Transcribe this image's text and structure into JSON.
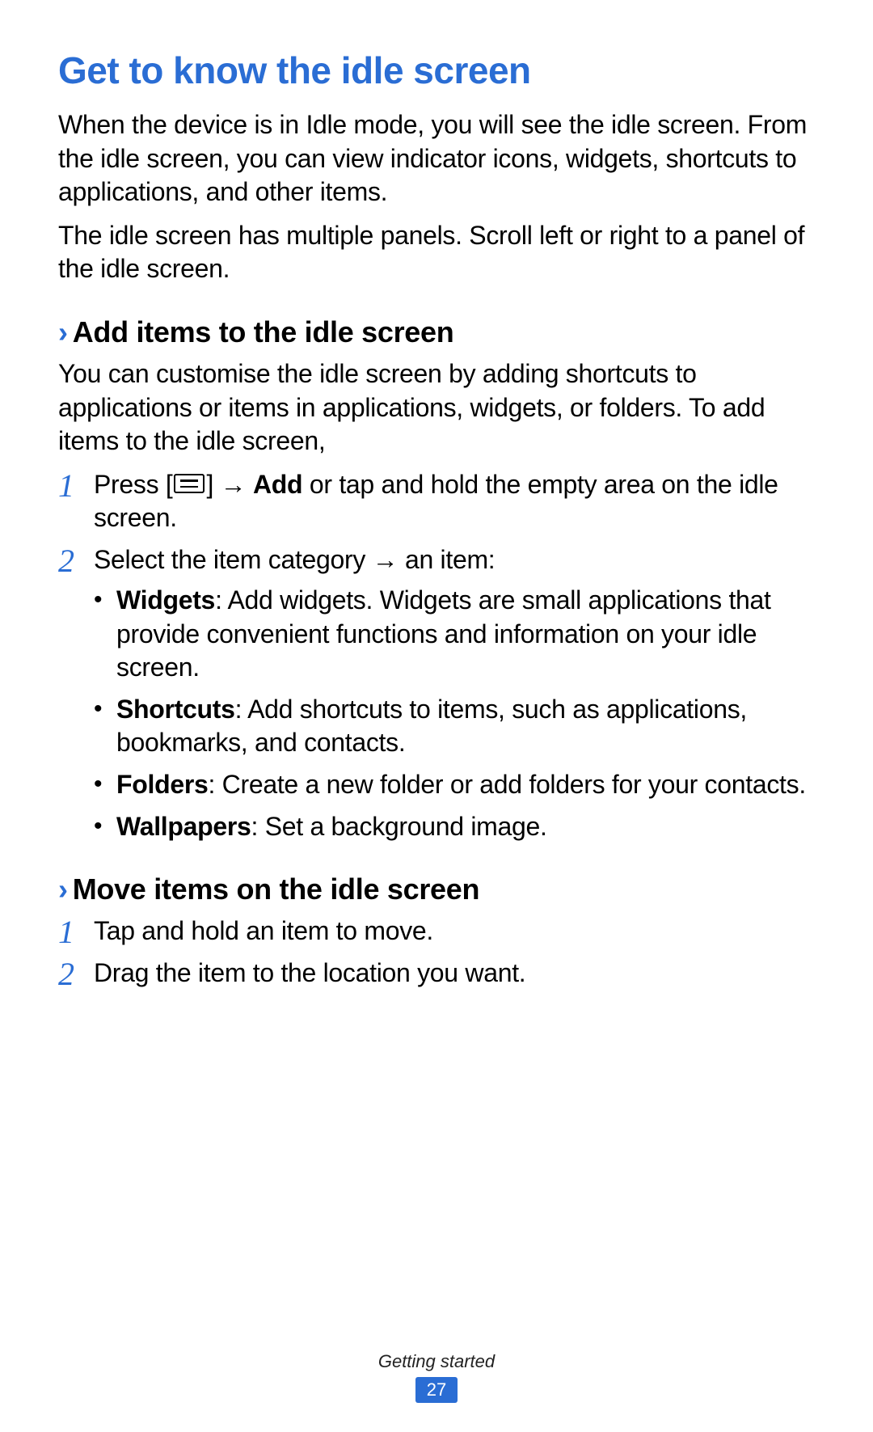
{
  "title": "Get to know the idle screen",
  "intro1": "When the device is in Idle mode, you will see the idle screen. From the idle screen, you can view indicator icons, widgets, shortcuts to applications, and other items.",
  "intro2": "The idle screen has multiple panels. Scroll left or right to a panel of the idle screen.",
  "section_add": {
    "heading": "Add items to the idle screen",
    "desc": "You can customise the idle screen by adding shortcuts to applications or items in applications, widgets, or folders. To add items to the idle screen,",
    "step1_pre": "Press [",
    "step1_post": "] → ",
    "step1_bold": "Add",
    "step1_tail": " or tap and hold the empty area on the idle screen.",
    "step2": "Select the item category → an item:",
    "bullets": [
      {
        "bold": "Widgets",
        "text": ": Add widgets. Widgets are small applications that provide convenient functions and information on your idle screen."
      },
      {
        "bold": "Shortcuts",
        "text": ": Add shortcuts to items, such as applications, bookmarks, and contacts."
      },
      {
        "bold": "Folders",
        "text": ": Create a new folder or add folders for your contacts."
      },
      {
        "bold": "Wallpapers",
        "text": ": Set a background image."
      }
    ]
  },
  "section_move": {
    "heading": "Move items on the idle screen",
    "step1": "Tap and hold an item to move.",
    "step2": "Drag the item to the location you want."
  },
  "footer": {
    "section": "Getting started",
    "page": "27"
  },
  "nums": {
    "one": "1",
    "two": "2"
  },
  "glyphs": {
    "chevron": "›",
    "bullet": "•"
  }
}
